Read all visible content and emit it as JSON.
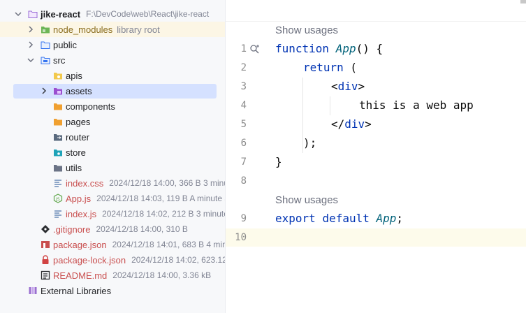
{
  "project": {
    "root": {
      "name": "jike-react",
      "path": "F:\\DevCode\\web\\React\\jike-react"
    },
    "node_modules": {
      "name": "node_modules",
      "note": "library root"
    },
    "public": {
      "name": "public"
    },
    "src": {
      "name": "src"
    },
    "src_dirs": [
      {
        "name": "apis",
        "icon": "folder-api-icon"
      },
      {
        "name": "assets",
        "icon": "folder-assets-icon"
      },
      {
        "name": "components",
        "icon": "folder-components-icon"
      },
      {
        "name": "pages",
        "icon": "folder-pages-icon"
      },
      {
        "name": "router",
        "icon": "folder-router-icon"
      },
      {
        "name": "store",
        "icon": "folder-store-icon"
      },
      {
        "name": "utils",
        "icon": "folder-utils-icon"
      }
    ],
    "src_files": [
      {
        "name": "index.css",
        "meta": "2024/12/18 14:00, 366 B 3 minute"
      },
      {
        "name": "App.js",
        "meta": "2024/12/18 14:03, 119 B A minute a"
      },
      {
        "name": "index.js",
        "meta": "2024/12/18 14:02, 212 B 3 minutes"
      }
    ],
    "root_files": [
      {
        "name": ".gitignore",
        "meta": "2024/12/18 14:00, 310 B"
      },
      {
        "name": "package.json",
        "meta": "2024/12/18 14:01, 683 B 4 minu"
      },
      {
        "name": "package-lock.json",
        "meta": "2024/12/18 14:02, 623.12 k"
      },
      {
        "name": "README.md",
        "meta": "2024/12/18 14:00, 3.36 kB"
      }
    ],
    "external": {
      "name": "External Libraries"
    }
  },
  "editor": {
    "usage_hint": "Show usages",
    "line_numbers": [
      "1",
      "2",
      "3",
      "4",
      "5",
      "6",
      "7",
      "8",
      "9",
      "10"
    ],
    "code": {
      "kw_function": "function",
      "fn_app": "App",
      "parens_brace": "() {",
      "kw_return": "return",
      "open_paren": " (",
      "lt": "<",
      "div": "div",
      "gt": ">",
      "text": "this is a web app",
      "lt_close": "</",
      "close_paren": ");",
      "close_brace": "}",
      "kw_export": "export",
      "kw_default": "default",
      "semicolon": ";"
    }
  },
  "colors": {
    "selection": "#d5e1ff",
    "library_root_highlight": "#fcf6e5",
    "keyword": "#0033b3",
    "git_untracked": "#c94f4f"
  }
}
